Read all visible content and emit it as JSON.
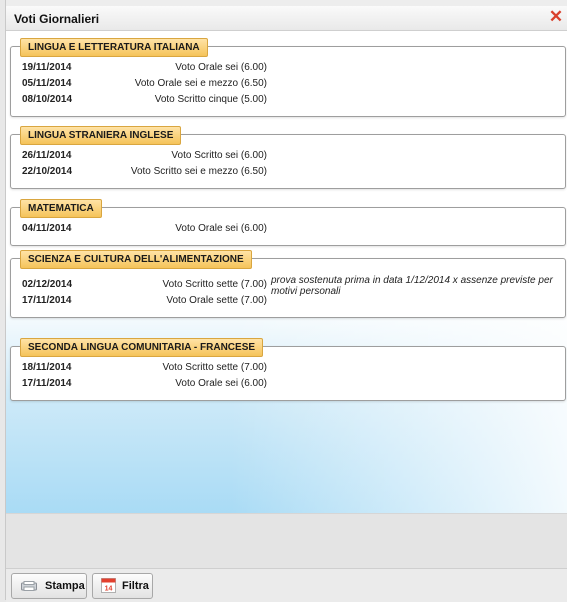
{
  "window": {
    "title": "Voti Giornalieri",
    "close_glyph": "✕"
  },
  "subjects": [
    {
      "name": "LINGUA E LETTERATURA ITALIANA",
      "votes": [
        {
          "date": "19/11/2014",
          "description": "Voto Orale sei (6.00)",
          "note": ""
        },
        {
          "date": "05/11/2014",
          "description": "Voto Orale sei e mezzo (6.50)",
          "note": ""
        },
        {
          "date": "08/10/2014",
          "description": "Voto Scritto cinque (5.00)",
          "note": ""
        }
      ]
    },
    {
      "name": "LINGUA STRANIERA INGLESE",
      "votes": [
        {
          "date": "26/11/2014",
          "description": "Voto Scritto sei (6.00)",
          "note": ""
        },
        {
          "date": "22/10/2014",
          "description": "Voto Scritto sei e mezzo (6.50)",
          "note": ""
        }
      ]
    },
    {
      "name": "MATEMATICA",
      "votes": [
        {
          "date": "04/11/2014",
          "description": "Voto Orale sei (6.00)",
          "note": ""
        }
      ]
    },
    {
      "name": "SCIENZA E CULTURA DELL'ALIMENTAZIONE",
      "votes": [
        {
          "date": "02/12/2014",
          "description": "Voto Scritto sette (7.00)",
          "note": "prova sostenuta prima in data 1/12/2014 x assenze previste per motivi personali"
        },
        {
          "date": "17/11/2014",
          "description": "Voto Orale sette (7.00)",
          "note": ""
        }
      ]
    },
    {
      "name": "SECONDA LINGUA COMUNITARIA - FRANCESE",
      "votes": [
        {
          "date": "18/11/2014",
          "description": "Voto Scritto sette (7.00)",
          "note": ""
        },
        {
          "date": "17/11/2014",
          "description": "Voto Orale sei (6.00)",
          "note": ""
        }
      ]
    }
  ],
  "toolbar": {
    "print_label": "Stampa",
    "filter_label": "Filtra",
    "calendar_day": "14",
    "print_icon": "printer-icon",
    "filter_icon": "calendar-icon"
  },
  "colors": {
    "tag_fill": "#f5c35a",
    "close": "#d9402c",
    "calendar_red": "#e2402e"
  }
}
